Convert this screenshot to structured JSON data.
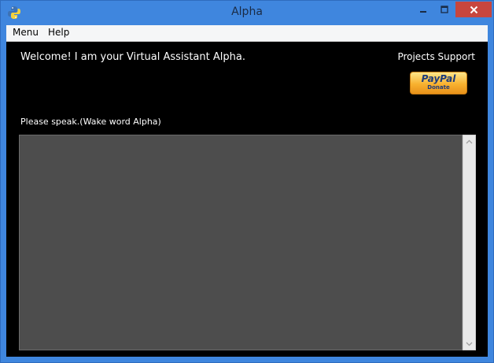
{
  "window": {
    "title": "Alpha",
    "icon": "python-icon"
  },
  "menubar": {
    "items": [
      {
        "label": "Menu"
      },
      {
        "label": "Help"
      }
    ]
  },
  "main": {
    "welcome_text": "Welcome! I am your Virtual Assistant Alpha.",
    "projects_support_label": "Projects Support",
    "paypal": {
      "brand": "PayPal",
      "action": "Donate"
    },
    "prompt_text": "Please speak.(Wake word Alpha)",
    "transcript_value": ""
  },
  "colors": {
    "title_bar": "#3f86de",
    "close_button": "#c7463e",
    "client_background": "#000000",
    "text_area_background": "#4d4d4d",
    "paypal_gold": "#f8b12f",
    "paypal_blue": "#1d3b7a"
  }
}
